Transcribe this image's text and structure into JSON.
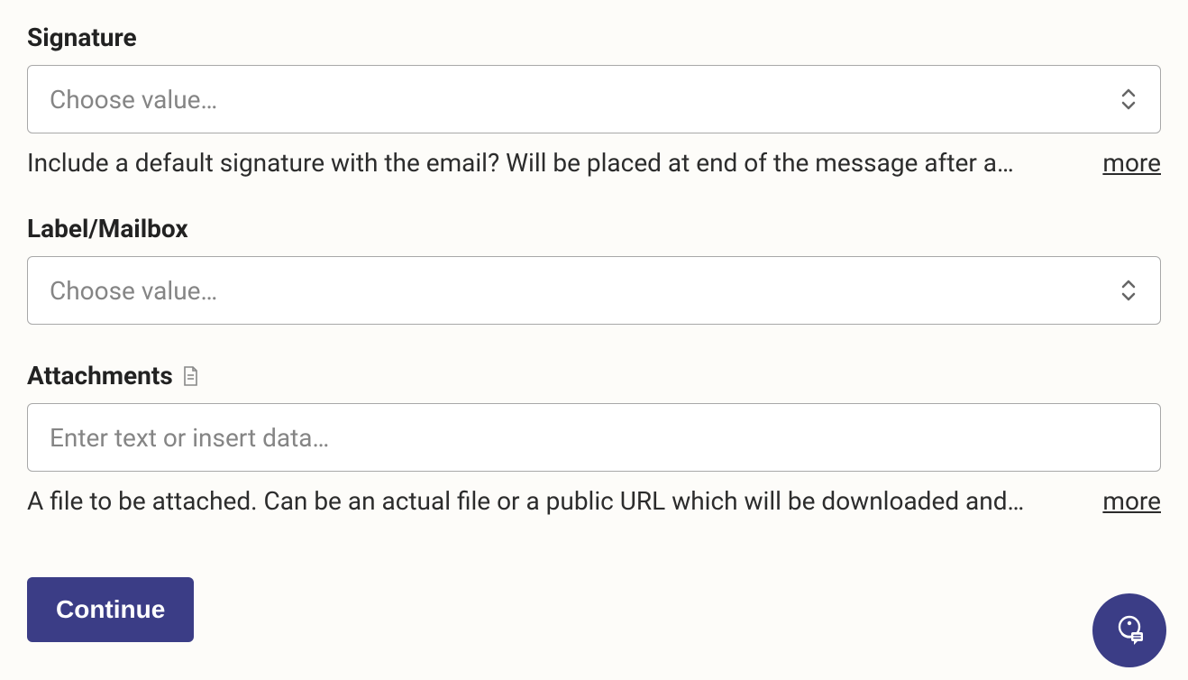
{
  "fields": {
    "signature": {
      "label": "Signature",
      "placeholder": "Choose value…",
      "help": "Include a default signature with the email? Will be placed at end of the message after a…",
      "more": "more"
    },
    "label_mailbox": {
      "label": "Label/Mailbox",
      "placeholder": "Choose value…"
    },
    "attachments": {
      "label": "Attachments",
      "placeholder": "Enter text or insert data…",
      "help": "A file to be attached. Can be an actual file or a public URL which will be downloaded and…",
      "more": "more"
    }
  },
  "buttons": {
    "continue": "Continue"
  }
}
